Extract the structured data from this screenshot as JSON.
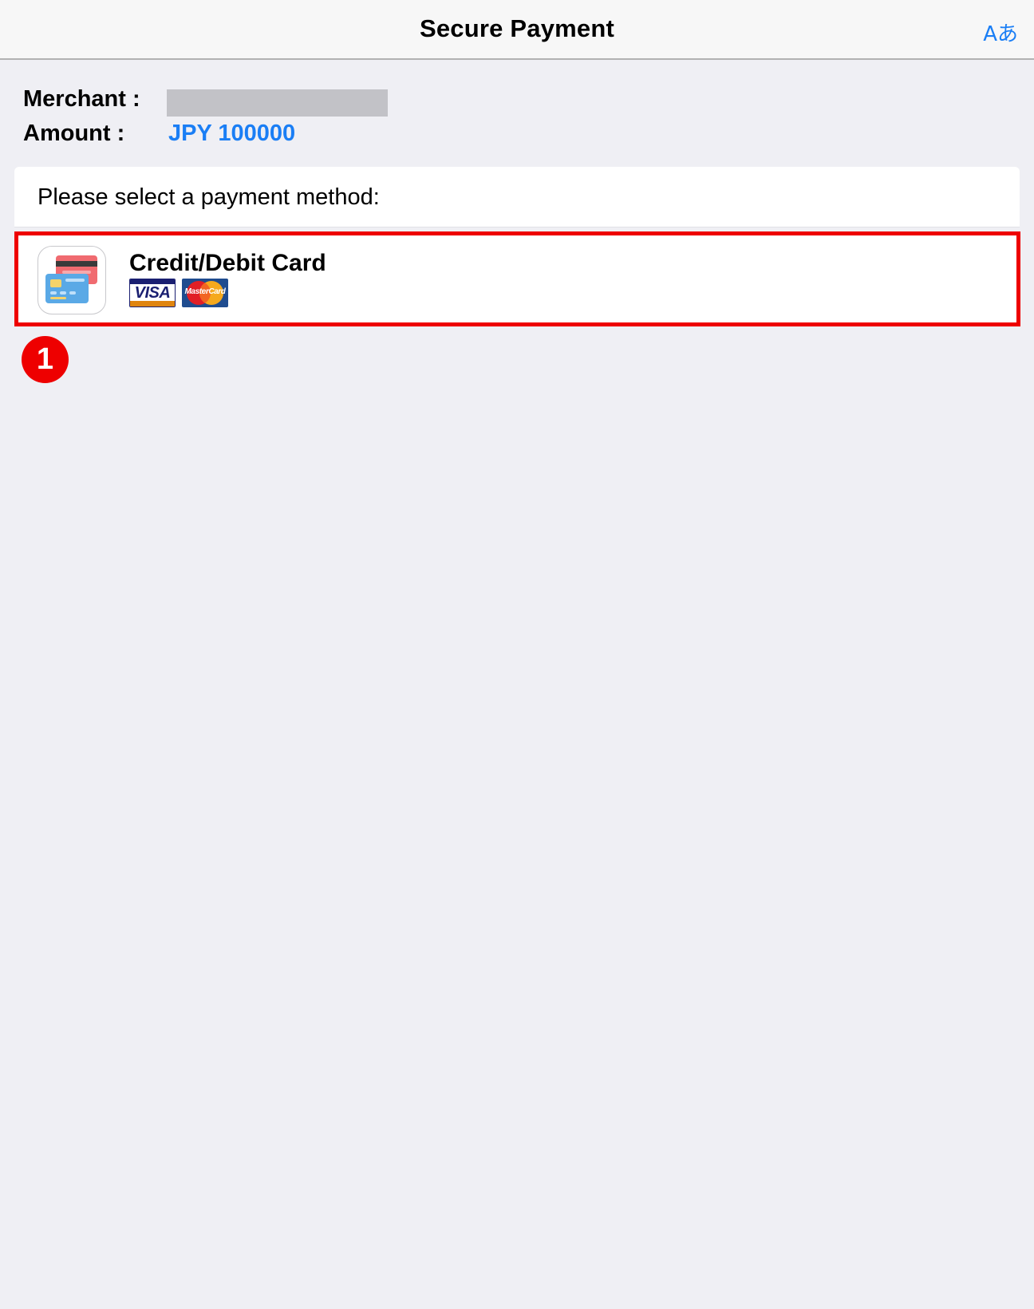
{
  "navbar": {
    "title": "Secure Payment",
    "language_label": "Aあ"
  },
  "info": {
    "merchant_label": "Merchant :",
    "amount_label": "Amount :",
    "amount_value": "JPY 100000"
  },
  "payment": {
    "prompt": "Please select a payment method:",
    "methods": [
      {
        "title": "Credit/Debit Card",
        "icon": "credit-card-icon",
        "brands": [
          "VISA",
          "MasterCard"
        ]
      }
    ]
  },
  "annotation": {
    "step_number": "1"
  },
  "colors": {
    "accent": "#1a7ef5",
    "highlight": "#ee0000",
    "background": "#efeff4"
  }
}
